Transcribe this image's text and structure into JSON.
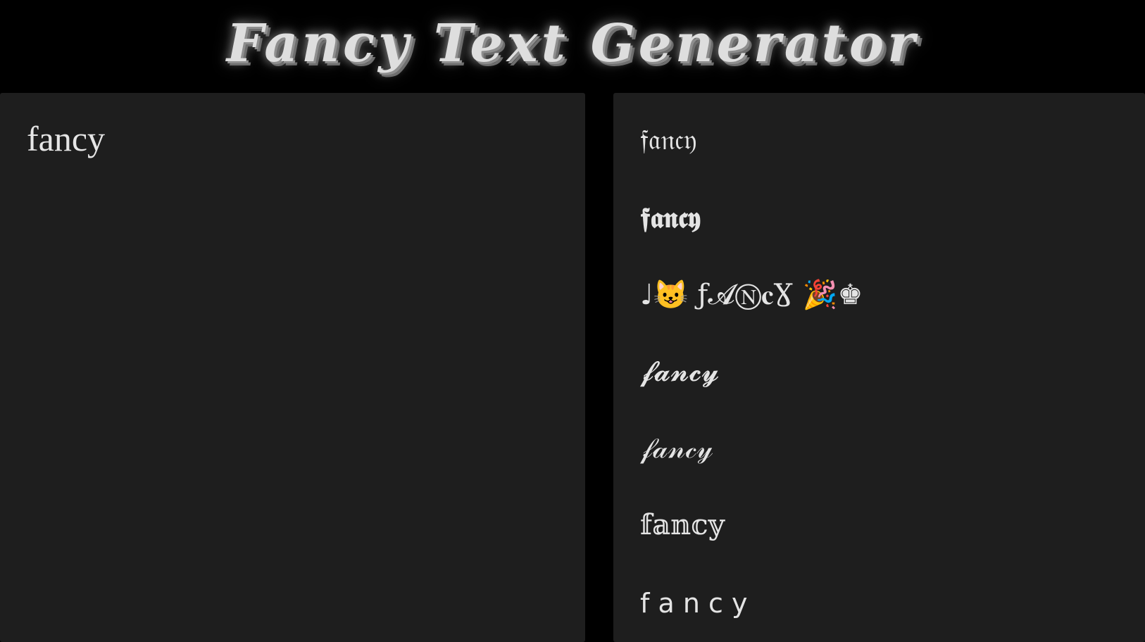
{
  "header": {
    "title": "Fancy Text Generator"
  },
  "input": {
    "value": "fancy"
  },
  "results": [
    "𝔣𝔞𝔫𝔠𝔶",
    "𝖋𝖆𝖓𝖈𝖞",
    "♩😺  ƒ𝓐Ⓝ𝐜Ɣ  🎉♚",
    "𝓯𝓪𝓷𝓬𝔂",
    "𝒻𝒶𝓃𝒸𝓎",
    "𝕗𝕒𝕟𝕔𝕪",
    " f  a  n  c  y"
  ]
}
